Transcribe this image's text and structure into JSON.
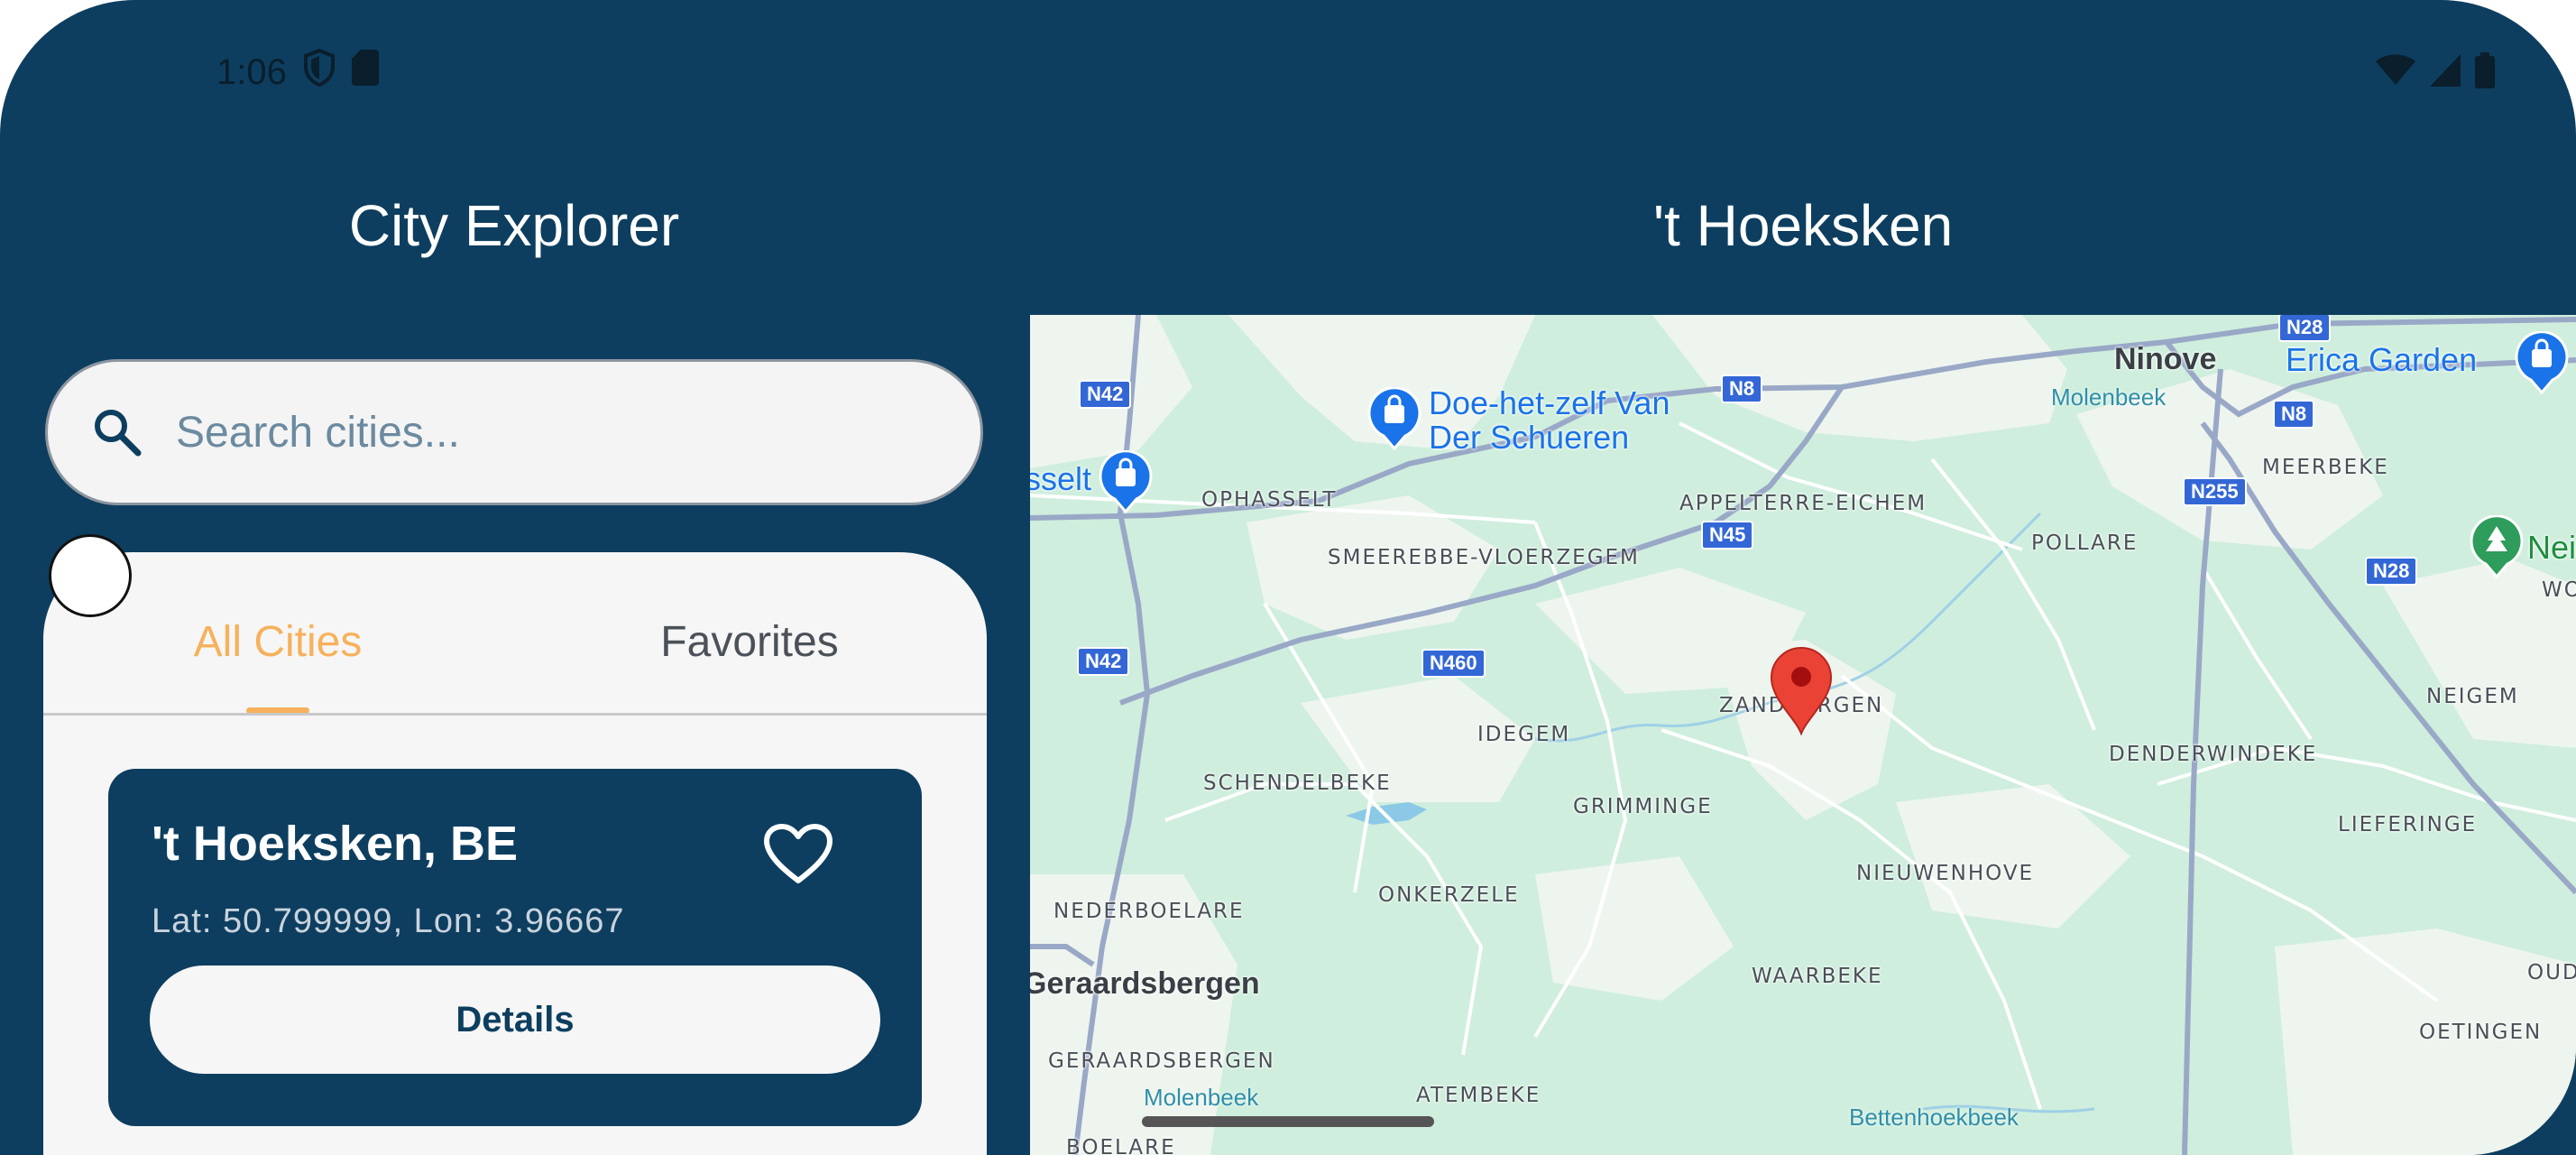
{
  "status_bar": {
    "time": "1:06",
    "icons": [
      "shield-icon",
      "sim-card-icon",
      "wifi-icon",
      "signal-icon",
      "battery-icon"
    ]
  },
  "app": {
    "title": "City Explorer",
    "detail_title": "'t Hoeksken"
  },
  "search": {
    "placeholder": "Search cities...",
    "value": ""
  },
  "tabs": [
    {
      "label": "All Cities",
      "selected": true
    },
    {
      "label": "Favorites",
      "selected": false
    }
  ],
  "cities": [
    {
      "name": "'t Hoeksken, BE",
      "coords": "Lat: 50.799999, Lon: 3.96667",
      "details_label": "Details",
      "favorite": false
    }
  ],
  "map": {
    "roads": [
      "N42",
      "N8",
      "N28",
      "N45",
      "N255",
      "N460"
    ],
    "places": [
      "OPHASSELT",
      "APPELTERRE-EICHEM",
      "SMEEREBBE-VLOERZEGEM",
      "POLLARE",
      "MEERBEKE",
      "NEIGEM",
      "IDEGEM",
      "ZANDBERGEN",
      "SCHENDELBEKE",
      "GRIMMINGE",
      "DENDERWINDEKE",
      "LIEFERINGE",
      "NIEUWENHOVE",
      "NEDERBOELARE",
      "ONKERZELE",
      "WAARBEKE",
      "OETINGEN",
      "GERAARDSBERGEN",
      "ATEMBEKE",
      "OUD",
      "WO",
      "BOELARE"
    ],
    "towns": [
      "Ninove",
      "Geraardsbergen"
    ],
    "pois": [
      "Doe-het-zelf Van",
      "Der Schueren",
      "Erica Garden",
      "sselt",
      "Neig"
    ],
    "water": [
      "Molenbeek",
      "Molenbeek",
      "Bettenhoekbeek"
    ]
  },
  "colors": {
    "primary": "#0d3e5f",
    "accent": "#f7b15c",
    "surface": "#f6f6f6",
    "map_green": "#cfeedd",
    "map_road": "#3367d6",
    "marker": "#ea4335"
  }
}
